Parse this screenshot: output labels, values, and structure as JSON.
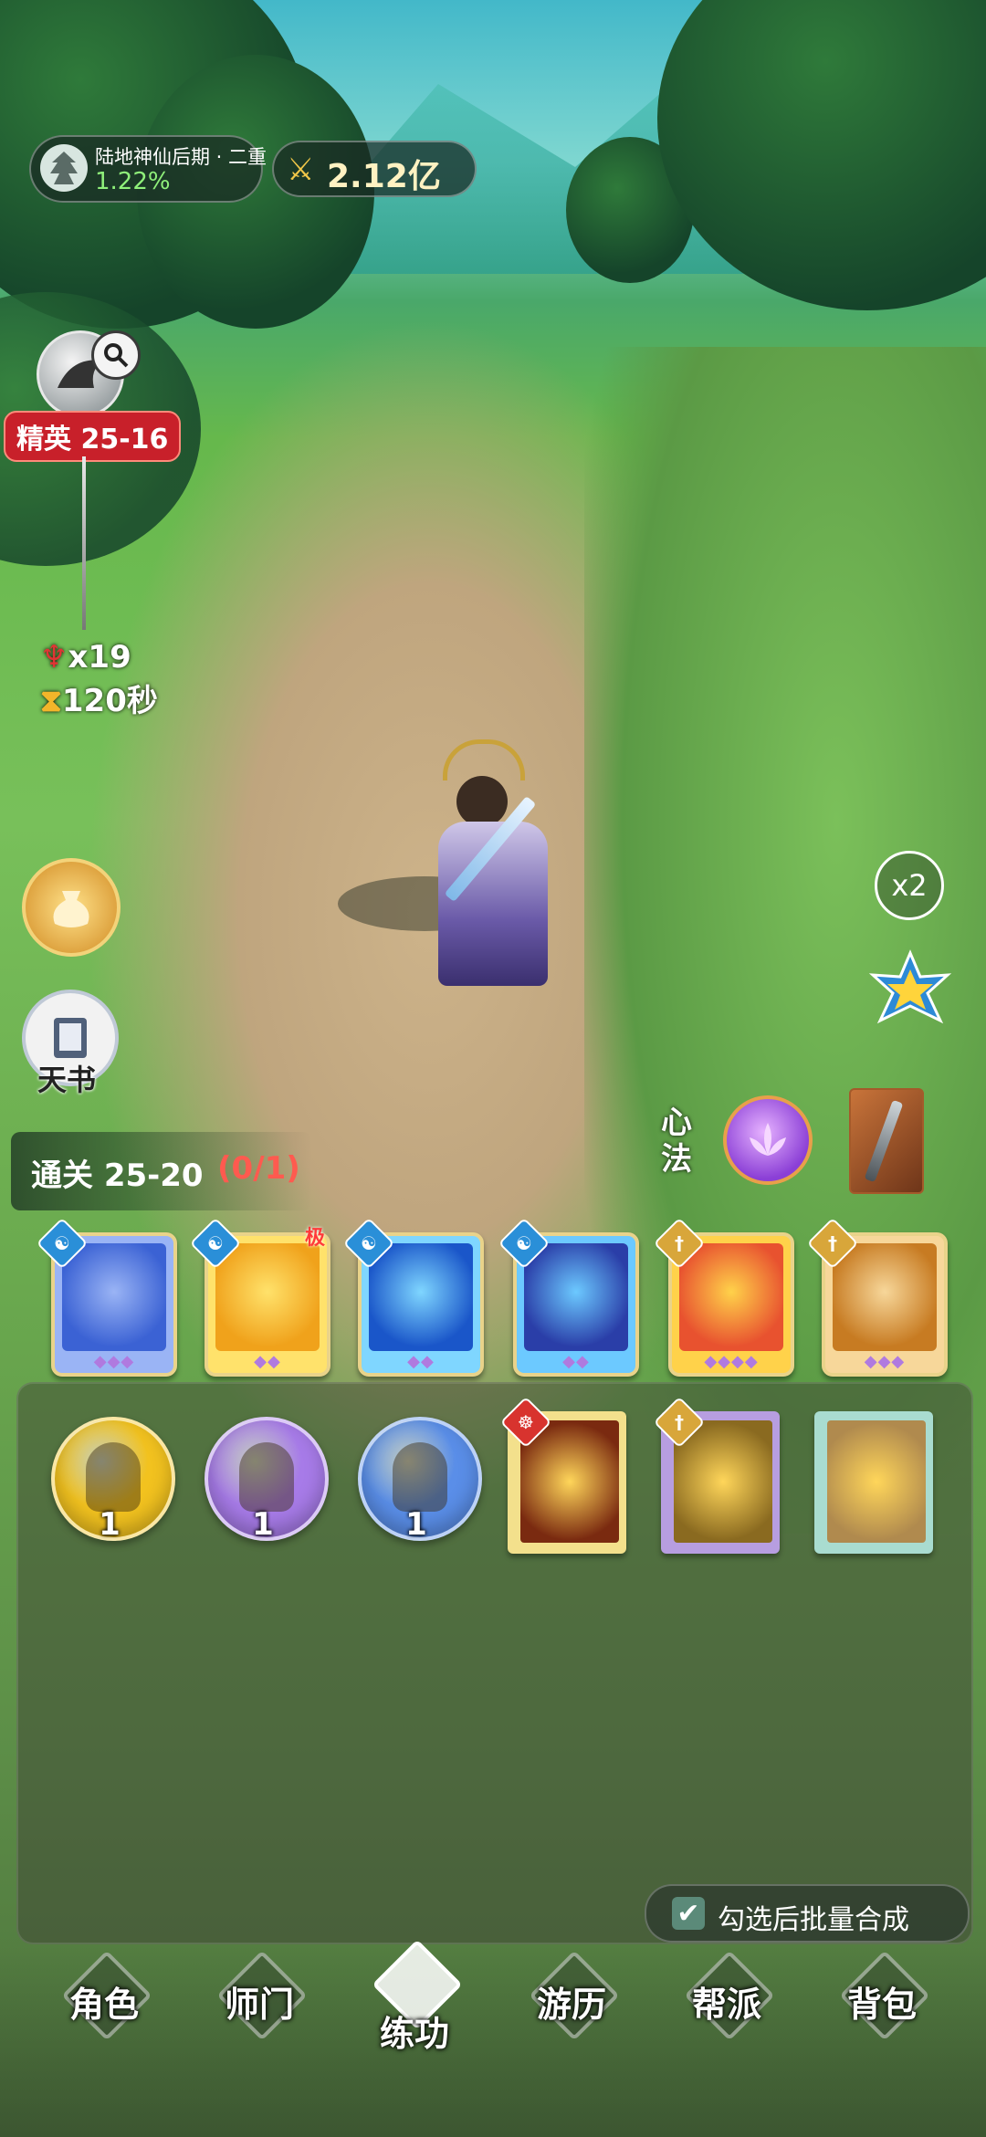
{
  "player": {
    "realm": "陆地神仙后期 · 二重",
    "progress": "1.22%",
    "power": "2.12亿"
  },
  "stage": {
    "label": "精英 25-16",
    "enemy_count": "x19",
    "timer": "120秒"
  },
  "side": {
    "tianshu_label": "天书",
    "speed": "x2"
  },
  "mission": {
    "text": "通关 25-20",
    "progress": "(0/1)"
  },
  "xinfa": {
    "label_line1": "心",
    "label_line2": "法"
  },
  "skill_cards": [
    {
      "name": "taiji-card",
      "pips": "◆◆◆",
      "colors": [
        "#3b62d4",
        "#9ab4f5"
      ],
      "badge": "yin-yang",
      "extreme": ""
    },
    {
      "name": "golden-dragon-card",
      "pips": "◆◆",
      "colors": [
        "#f0a21b",
        "#ffe26b"
      ],
      "badge": "yin-yang",
      "extreme": "极"
    },
    {
      "name": "ice-burst-card",
      "pips": "◆◆",
      "colors": [
        "#1a56c9",
        "#7fd6ff"
      ],
      "badge": "yin-yang",
      "extreme": ""
    },
    {
      "name": "crystal-card",
      "pips": "◆◆",
      "colors": [
        "#2a3ea8",
        "#6cc9ff"
      ],
      "badge": "yin-yang",
      "extreme": ""
    },
    {
      "name": "rainbow-sword-card",
      "pips": "◆◆◆◆",
      "colors": [
        "#e8522f",
        "#ffd24a"
      ],
      "badge": "sword",
      "extreme": ""
    },
    {
      "name": "sword-dance-card",
      "pips": "◆◆◆",
      "colors": [
        "#c77b22",
        "#f7d79a"
      ],
      "badge": "sword",
      "extreme": ""
    }
  ],
  "orbs": [
    {
      "name": "gold-orb",
      "count": "1",
      "color": "#f2c21f"
    },
    {
      "name": "purple-orb",
      "count": "1",
      "color": "#a77be8"
    },
    {
      "name": "blue-orb",
      "count": "1",
      "color": "#5a8ee8"
    }
  ],
  "books": [
    {
      "name": "lotus-book",
      "cover": "#f3e08c",
      "inner": "#7a2a10",
      "badge": "meditate"
    },
    {
      "name": "blade-book",
      "cover": "#b79ee0",
      "inner": "#8a6a20",
      "badge": "sword"
    },
    {
      "name": "feather-book",
      "cover": "#a9dcd0",
      "inner": "#b08a4e",
      "badge": ""
    }
  ],
  "batch_merge": {
    "label": "勾选后批量合成",
    "checked": true
  },
  "nav": {
    "items": [
      "角色",
      "师门",
      "练功",
      "游历",
      "帮派",
      "背包"
    ],
    "active": "练功"
  },
  "colors": {
    "stage_red": "#c8202a",
    "mission_progress_red": "#ff5a4f",
    "progress_green": "#8ff07a"
  }
}
